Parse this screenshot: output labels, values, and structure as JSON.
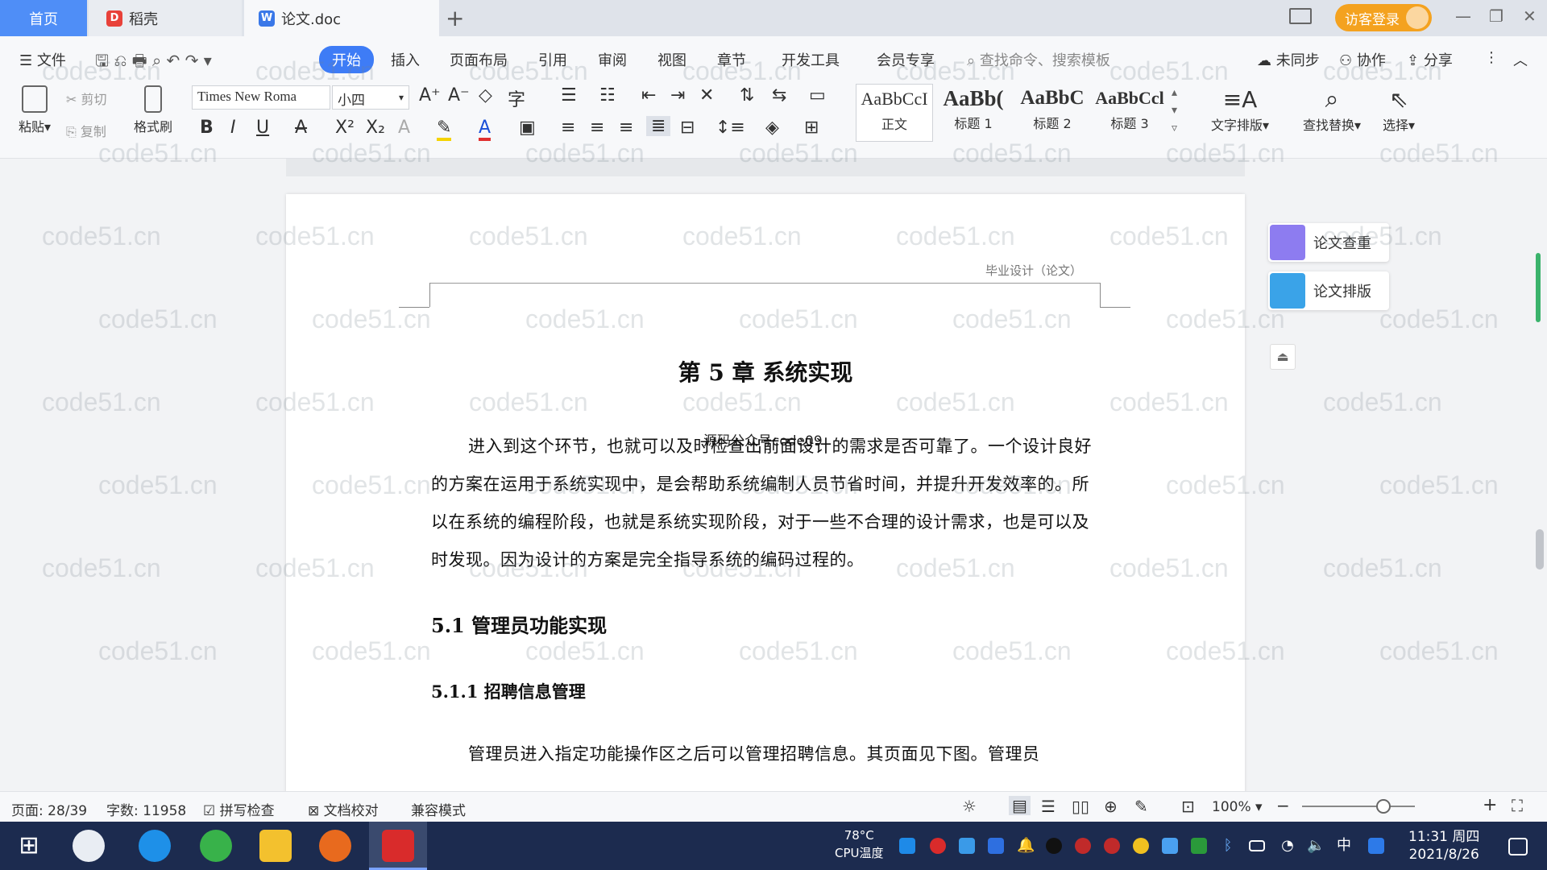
{
  "tabs": {
    "home": "首页",
    "daoke": "稻壳",
    "doc": "论文.doc"
  },
  "guest_login": "访客登录",
  "menu": {
    "file": "文件",
    "items": [
      "开始",
      "插入",
      "页面布局",
      "引用",
      "审阅",
      "视图",
      "章节",
      "开发工具",
      "会员专享"
    ],
    "search_placeholder": "查找命令、搜索模板",
    "unsync": "未同步",
    "collab": "协作",
    "share": "分享"
  },
  "ribbon": {
    "paste": "粘贴",
    "cut": "剪切",
    "copy": "复制",
    "format_painter": "格式刷",
    "font_name": "Times New Roma",
    "font_size": "小四",
    "styles": [
      {
        "preview": "AaBbCcI",
        "label": "正文"
      },
      {
        "preview": "AaBb(",
        "label": "标题 1"
      },
      {
        "preview": "AaBbC",
        "label": "标题 2"
      },
      {
        "preview": "AaBbCcl",
        "label": "标题 3"
      }
    ],
    "text_layout": "文字排版",
    "find_replace": "查找替换",
    "select": "选择"
  },
  "document": {
    "header_text": "毕业设计（论文）",
    "chapter_title": "第 5 章  系统实现",
    "overlay_text": "源码公众号code09",
    "paragraph1": "进入到这个环节，也就可以及时检查出前面设计的需求是否可靠了。一个设计良好的方案在运用于系统实现中，是会帮助系统编制人员节省时间，并提升开发效率的。所以在系统的编程阶段，也就是系统实现阶段，对于一些不合理的设计需求，也是可以及时发现。因为设计的方案是完全指导系统的编码过程的。",
    "section_title": "5.1  管理员功能实现",
    "subsection_title": "5.1.1  招聘信息管理",
    "paragraph2": "管理员进入指定功能操作区之后可以管理招聘信息。其页面见下图。管理员"
  },
  "side_panel": {
    "plagiarism": "论文查重",
    "layout": "论文排版"
  },
  "watermark": "code51.cn",
  "status": {
    "page": "页面: 28/39",
    "words": "字数: 11958",
    "spell": "拼写检查",
    "proof": "文档校对",
    "compat": "兼容模式",
    "zoom": "100%"
  },
  "taskbar": {
    "cpu_temp": "78°C",
    "cpu_label": "CPU温度",
    "ime": "中",
    "time": "11:31 周四",
    "date": "2021/8/26"
  }
}
